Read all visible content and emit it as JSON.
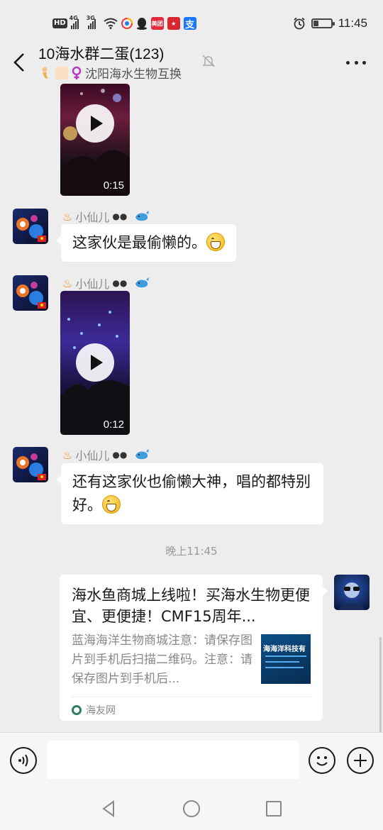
{
  "status_bar": {
    "left_icons": [
      "hd-icon",
      "4g-signal-icon",
      "3g-signal-icon",
      "wifi-icon",
      "browser-icon",
      "qq-icon",
      "meituan-icon",
      "sports-app-icon",
      "alipay-icon"
    ],
    "hd": "HD",
    "signal1_label": "4G",
    "signal2_label": "3G",
    "meituan_label": "美团",
    "time": "11:45",
    "battery_level": 0.3,
    "right_icons": [
      "alarm-icon",
      "battery-icon"
    ]
  },
  "header": {
    "back_icon": "back-arrow-icon",
    "title": "10海水群二蛋(123)",
    "subtitle": "沈阳海水生物互换",
    "subtitle_prefix_icons": [
      "mermaid-emoji-icon",
      "square-emoji-icon",
      "female-sign-icon"
    ],
    "mute_icon": "muted-bell-icon",
    "more_icon": "more-dots-icon"
  },
  "messages": [
    {
      "type": "video",
      "duration": "0:15",
      "partial": true
    },
    {
      "type": "text",
      "sender": "小仙儿",
      "text": "这家伙是最偷懒的。",
      "emoji": "grin-emoji-icon"
    },
    {
      "type": "video",
      "sender": "小仙儿",
      "duration": "0:12"
    },
    {
      "type": "text",
      "sender": "小仙儿",
      "text": "还有这家伙也偷懒大神，唱的都特别好。",
      "emoji": "grin-emoji-icon"
    }
  ],
  "sender_decorations": [
    "fire-emoji-icon",
    "eyes-emoji-icon",
    "whale-emoji-icon"
  ],
  "timestamp": "晚上11:45",
  "link_card": {
    "title": "海水鱼商城上线啦！买海水生物更便宜、更便捷！CMF15周年...",
    "description": "蓝海海洋生物商城注意：请保存图片到手机后扫描二维码。注意：请保存图片到手机后...",
    "thumbnail_text": "海海洋科技有",
    "source": "海友网",
    "source_icon": "haiyou-logo-icon"
  },
  "input_bar": {
    "voice_icon": "voice-icon",
    "placeholder": "",
    "emoji_icon": "smiley-icon",
    "plus_icon": "plus-icon"
  },
  "nav_bar": [
    "back-triangle-icon",
    "home-circle-icon",
    "recents-square-icon"
  ],
  "colors": {
    "background": "#ededed",
    "bubble": "#ffffff",
    "text": "#191919",
    "muted": "#888888"
  }
}
